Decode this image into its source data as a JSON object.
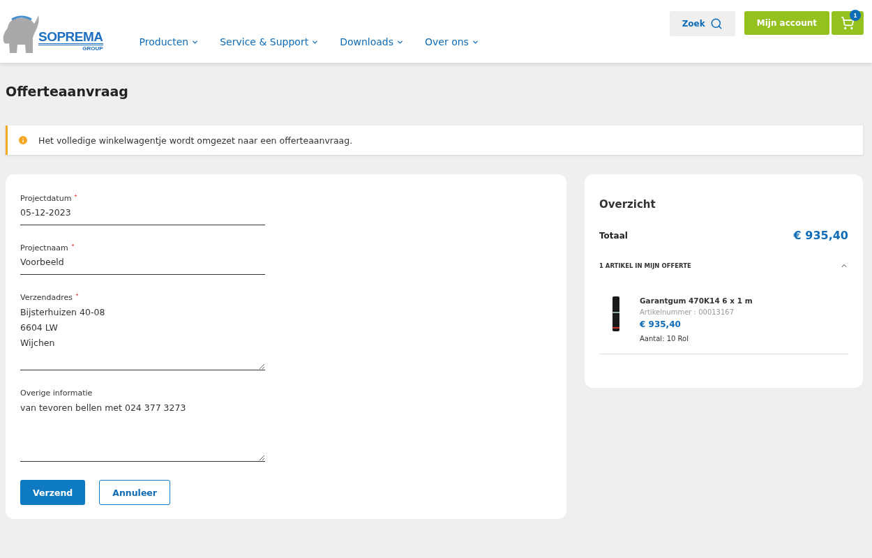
{
  "header": {
    "logo": {
      "name": "SOPREMA",
      "sub": "GROUP"
    },
    "nav": [
      {
        "label": "Producten"
      },
      {
        "label": "Service & Support"
      },
      {
        "label": "Downloads"
      },
      {
        "label": "Over ons"
      }
    ],
    "search": {
      "label": "Zoek"
    },
    "account": {
      "label": "Mijn account"
    },
    "cart": {
      "count": "1"
    }
  },
  "page": {
    "title": "Offerteaanvraag"
  },
  "alert": {
    "text": "Het volledige winkelwagentje wordt omgezet naar een offerteaanvraag."
  },
  "form": {
    "fields": [
      {
        "kind": "input",
        "label": "Projectdatum",
        "required": true,
        "value": "05-12-2023"
      },
      {
        "kind": "input",
        "label": "Projectnaam",
        "required": true,
        "value": "Voorbeeld"
      },
      {
        "kind": "textarea",
        "label": "Verzendadres",
        "required": true,
        "value": "Bijsterhuizen 40-08\n6604 LW\nWijchen"
      },
      {
        "kind": "textarea",
        "label": "Overige informatie",
        "required": false,
        "value": "van tevoren bellen met 024 377 3273"
      }
    ],
    "buttons": [
      {
        "kind": "primary",
        "label": "Verzend"
      },
      {
        "kind": "secondary",
        "label": "Annuleer"
      }
    ]
  },
  "summary": {
    "title": "Overzicht",
    "total_label": "Totaal",
    "total": "€ 935,40",
    "items_heading": "1 ARTIKEL IN MIJN OFFERTE",
    "expanded": true,
    "items": [
      {
        "name": "Garantgum 470K14 6 x 1 m",
        "number": "Artikelnummer : 00013167",
        "price": "€ 935,40",
        "quantity": "Aantal: 10 Rol"
      }
    ]
  }
}
